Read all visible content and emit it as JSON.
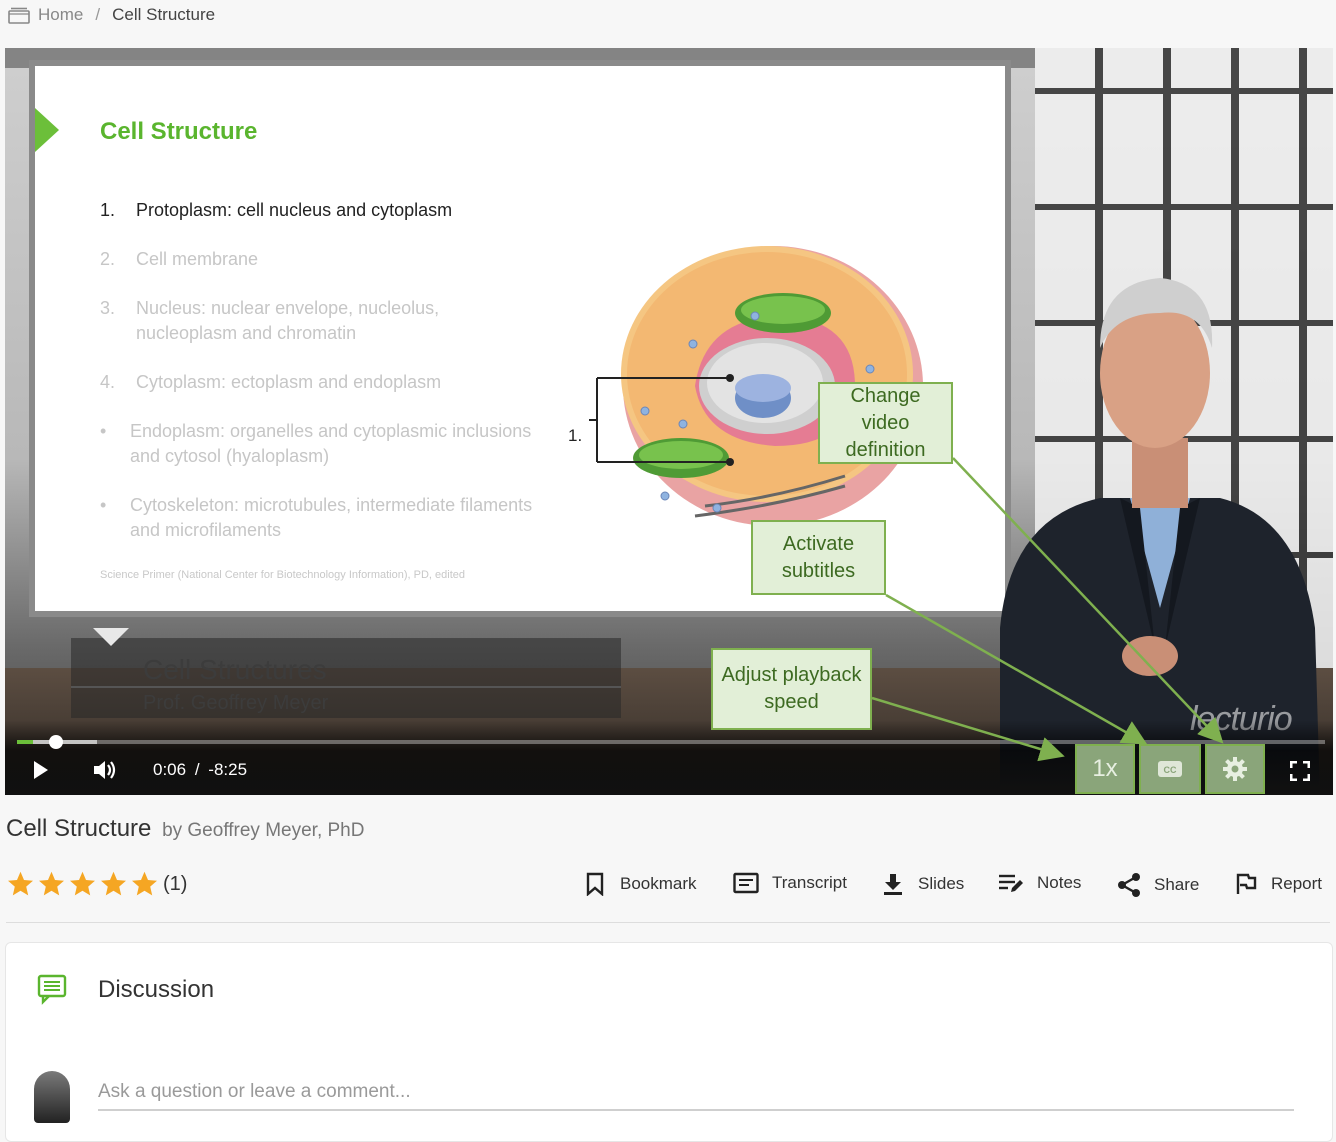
{
  "breadcrumb": {
    "home": "Home",
    "separator": "/",
    "current": "Cell Structure"
  },
  "slide": {
    "title": "Cell Structure",
    "items": [
      {
        "num": "1.",
        "text": "Protoplasm: cell nucleus and cytoplasm",
        "active": true
      },
      {
        "num": "2.",
        "text": "Cell membrane"
      },
      {
        "num": "3.",
        "text": "Nucleus: nuclear envelope, nucleolus, nucleoplasm and chromatin"
      },
      {
        "num": "4.",
        "text": "Cytoplasm: ectoplasm and endoplasm"
      },
      {
        "num": "•",
        "text": "Endoplasm: organelles and cytoplasmic inclusions and cytosol (hyaloplasm)"
      },
      {
        "num": "•",
        "text": "Cytoskeleton: microtubules, intermediate filaments and microfilaments"
      }
    ],
    "diagram_label": "1.",
    "source": "Science Primer (National Center for Biotechnology Information), PD, edited"
  },
  "lower_third": {
    "title": "Cell Structures",
    "subtitle": "Prof. Geoffrey Meyer"
  },
  "watermark": "lecturio",
  "controls": {
    "current_time": "0:06",
    "time_separator": "/",
    "remaining_time": "-8:25",
    "progress_fraction": 0.012,
    "speed_label": "1x"
  },
  "callouts": {
    "definition": "Change video definition",
    "subtitles": "Activate subtitles",
    "speed": "Adjust playback speed"
  },
  "lecture": {
    "title": "Cell Structure",
    "by": "by Geoffrey Meyer, PhD"
  },
  "rating": {
    "stars": 5,
    "count": "(1)"
  },
  "actions": {
    "bookmark": "Bookmark",
    "transcript": "Transcript",
    "slides": "Slides",
    "notes": "Notes",
    "share": "Share",
    "report": "Report"
  },
  "discussion": {
    "title": "Discussion",
    "placeholder": "Ask a question or leave a comment..."
  },
  "colors": {
    "accent_green": "#6cbf3a",
    "callout_fill": "#e2efd7",
    "callout_border": "#7fb04f",
    "star": "#f5a623"
  }
}
